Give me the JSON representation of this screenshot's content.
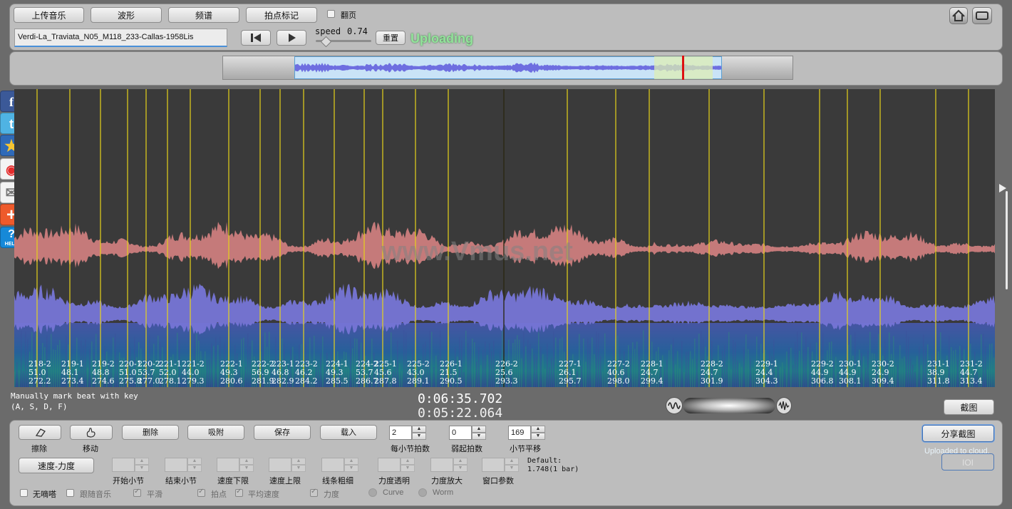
{
  "toolbar": {
    "upload_label": "上传音乐",
    "waveform_label": "波形",
    "spectrum_label": "频谱",
    "beat_mark_label": "拍点标记",
    "page_turn_label": "翻页"
  },
  "file": {
    "name": "Verdi-La_Traviata_N05_M118_233-Callas-1958Lis"
  },
  "playback": {
    "speed_label": "speed",
    "speed_value": "0.74",
    "speed_fraction": 0.74,
    "reset_label": "重置",
    "status_text": "Uploading"
  },
  "watermark": "www.Vmus.net",
  "social": [
    "facebook-icon",
    "twitter-icon",
    "favorite-star-icon",
    "weibo-icon",
    "email-icon",
    "add-more-icon",
    "help-icon"
  ],
  "help_text": "HELP",
  "beats": [
    {
      "label": "218-2",
      "tempo": "51.0",
      "time": "272.2"
    },
    {
      "label": "219-1",
      "tempo": "48.1",
      "time": "273.4"
    },
    {
      "label": "219-2",
      "tempo": "48.8",
      "time": "274.6"
    },
    {
      "label": "220-1",
      "tempo": "51.0",
      "time": "275.8"
    },
    {
      "label": "220-2",
      "tempo": "53.7",
      "time": "277.0"
    },
    {
      "label": "221-1",
      "tempo": "52.0",
      "time": "278.1"
    },
    {
      "label": "221-2",
      "tempo": "44.0",
      "time": "279.3"
    },
    {
      "label": "222-1",
      "tempo": "49.3",
      "time": "280.6"
    },
    {
      "label": "222-2",
      "tempo": "56.9",
      "time": "281.9"
    },
    {
      "label": "223-1",
      "tempo": "46.8",
      "time": "282.9"
    },
    {
      "label": "223-2",
      "tempo": "46.2",
      "time": "284.2"
    },
    {
      "label": "224-1",
      "tempo": "49.3",
      "time": "285.5"
    },
    {
      "label": "224-2",
      "tempo": "53.7",
      "time": "286.7"
    },
    {
      "label": "225-1",
      "tempo": "45.6",
      "time": "287.8"
    },
    {
      "label": "225-2",
      "tempo": "43.0",
      "time": "289.1"
    },
    {
      "label": "226-1",
      "tempo": "21.5",
      "time": "290.5"
    },
    {
      "label": "226-2",
      "tempo": "25.6",
      "time": "293.3"
    },
    {
      "label": "227-1",
      "tempo": "26.1",
      "time": "295.7"
    },
    {
      "label": "227-2",
      "tempo": "40.6",
      "time": "298.0"
    },
    {
      "label": "228-1",
      "tempo": "24.7",
      "time": "299.4"
    },
    {
      "label": "228-2",
      "tempo": "24.7",
      "time": "301.9"
    },
    {
      "label": "229-1",
      "tempo": "24.4",
      "time": "304.3"
    },
    {
      "label": "229-2",
      "tempo": "44.9",
      "time": "306.8"
    },
    {
      "label": "230-1",
      "tempo": "44.9",
      "time": "308.1"
    },
    {
      "label": "230-2",
      "tempo": "24.9",
      "time": "309.4"
    },
    {
      "label": "231-1",
      "tempo": "38.9",
      "time": "311.8"
    },
    {
      "label": "231-2",
      "tempo": "44.7",
      "time": "313.4"
    }
  ],
  "hint": {
    "line1": "Manually mark beat with key",
    "line2": "(A, S, D, F)"
  },
  "time": {
    "current": "0:06:35.702",
    "position": "0:05:22.064"
  },
  "screenshot_label": "截图",
  "controls": {
    "erase_label": "擦除",
    "move_label": "移动",
    "delete_label": "删除",
    "snap_label": "吸附",
    "save_label": "保存",
    "load_label": "载入",
    "beats_per_bar_value": "2",
    "beats_per_bar_label": "每小节拍数",
    "pickup_value": "0",
    "pickup_label": "弱起拍数",
    "bar_offset_value": "169",
    "bar_offset_label": "小节平移",
    "share_label": "分享截图",
    "uploaded_text": "Uploaded to cloud.",
    "ioi_label": "IOI",
    "tempo_dynamics_label": "速度-力度",
    "start_bar_label": "开始小节",
    "end_bar_label": "结束小节",
    "tempo_min_label": "速度下限",
    "tempo_max_label": "速度上限",
    "line_width_label": "线条粗细",
    "dyn_alpha_label": "力度透明",
    "dyn_zoom_label": "力度放大",
    "window_label": "窗口参数",
    "default_text": "Default:",
    "default_value": "1.748(1 bar)",
    "no_tick_label": "无嘀嗒",
    "follow_music_label": "跟随音乐",
    "smooth_label": "平滑",
    "beat_point_label": "拍点",
    "avg_tempo_label": "平均速度",
    "dynamics_label": "力度",
    "curve_label": "Curve",
    "worm_label": "Worm"
  }
}
